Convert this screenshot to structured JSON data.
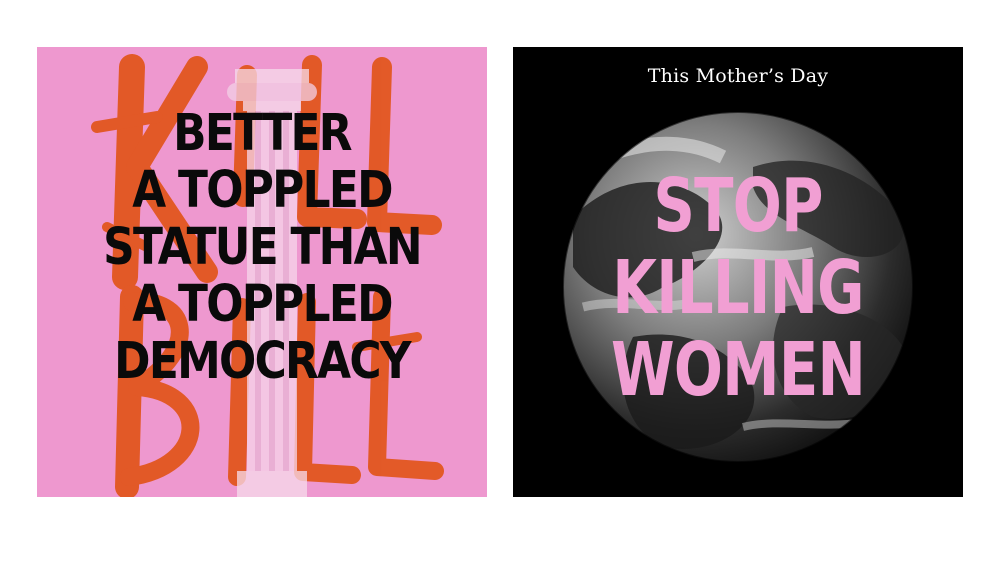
{
  "left_poster": {
    "lines": [
      "BETTER",
      "A TOPPLED",
      "STATUE THAN",
      "A TOPPLED",
      "DEMOCRACY"
    ],
    "background_color": "#ee98cf",
    "brush_color": "#e2561f",
    "text_color": "#0a0a0a",
    "column_icon": "column-statue-icon",
    "brush_lettering": "kill-bill-brush-lettering"
  },
  "right_poster": {
    "tagline": "This Mother’s Day",
    "lines": [
      "STOP",
      "KILLING",
      "WOMEN"
    ],
    "background_color": "#000000",
    "text_color": "#f19fd3",
    "globe_icon": "earth-globe-icon"
  }
}
